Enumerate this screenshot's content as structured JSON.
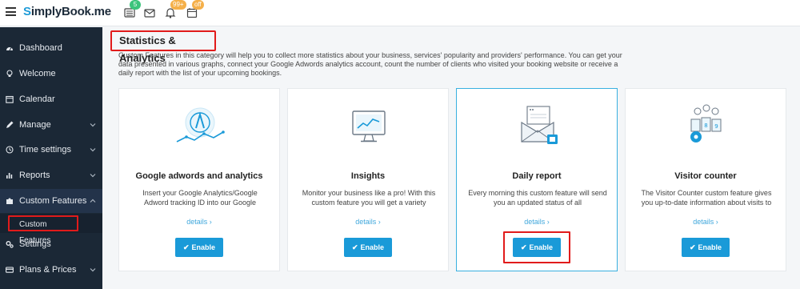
{
  "topbar": {
    "logo_prefix": "S",
    "logo_rest": "implyBook.me",
    "icons": [
      {
        "name": "list-icon",
        "badge": "5",
        "badge_color": "#3cc47c"
      },
      {
        "name": "mail-icon",
        "badge": "",
        "badge_color": ""
      },
      {
        "name": "bell-icon",
        "badge": "99+",
        "badge_color": "#f5b04a"
      },
      {
        "name": "calendar-off-icon",
        "badge": "off",
        "badge_color": "#f5b04a"
      }
    ]
  },
  "sidebar": {
    "items": [
      {
        "label": "Dashboard",
        "icon": "dashboard-icon",
        "has_chevron": false
      },
      {
        "label": "Welcome",
        "icon": "lightbulb-icon",
        "has_chevron": false
      },
      {
        "label": "Calendar",
        "icon": "calendar-icon",
        "has_chevron": false
      },
      {
        "label": "Manage",
        "icon": "pencil-icon",
        "has_chevron": true
      },
      {
        "label": "Time settings",
        "icon": "clock-icon",
        "has_chevron": true
      },
      {
        "label": "Reports",
        "icon": "bar-chart-icon",
        "has_chevron": true
      },
      {
        "label": "Custom Features",
        "icon": "puzzle-icon",
        "has_chevron": true
      },
      {
        "label": "Settings",
        "icon": "gears-icon",
        "has_chevron": false
      },
      {
        "label": "Plans & Prices",
        "icon": "card-icon",
        "has_chevron": true
      }
    ],
    "sub_item": "Custom Features"
  },
  "main": {
    "section_title": "Statistics & Analytics",
    "intro": "Custom Features in this category will help you to collect more statistics about your business, services' popularity and providers' performance. You can get your data presented in various graphs, connect your Google Adwords analytics account, count the number of clients who visited your booking website or receive a daily report with the list of your upcoming bookings.",
    "cards": [
      {
        "title": "Google adwords and analytics",
        "description": "Insert your Google Analytics/Google Adword tracking ID into our Google",
        "details": "details ›",
        "button": "Enable",
        "icon": "analytics-icon"
      },
      {
        "title": "Insights",
        "description": "Monitor your business like a pro! With this custom feature you will get a variety",
        "details": "details ›",
        "button": "Enable",
        "icon": "monitor-chart-icon"
      },
      {
        "title": "Daily report",
        "description": "Every morning this custom feature will send you an updated status of all",
        "details": "details ›",
        "button": "Enable",
        "icon": "envelope-report-icon"
      },
      {
        "title": "Visitor counter",
        "description": "The Visitor Counter custom feature gives you up-to-date information about visits to",
        "details": "details ›",
        "button": "Enable",
        "icon": "visitor-counter-icon"
      }
    ]
  },
  "colors": {
    "accent": "#1a9ad8",
    "sidebar_bg": "#1b2836",
    "highlight": "#e11b1b"
  }
}
